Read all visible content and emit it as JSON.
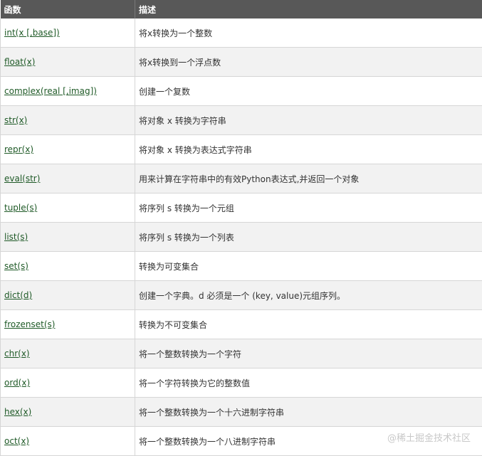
{
  "table": {
    "headers": [
      "函数",
      "描述"
    ],
    "rows": [
      {
        "fn": "int(x [,base])",
        "desc": "将x转换为一个整数"
      },
      {
        "fn": "float(x)",
        "desc": "将x转换到一个浮点数"
      },
      {
        "fn": "complex(real [,imag])",
        "desc": "创建一个复数"
      },
      {
        "fn": "str(x)",
        "desc": "将对象 x 转换为字符串"
      },
      {
        "fn": "repr(x)",
        "desc": "将对象 x 转换为表达式字符串"
      },
      {
        "fn": "eval(str)",
        "desc": "用来计算在字符串中的有效Python表达式,并返回一个对象"
      },
      {
        "fn": "tuple(s)",
        "desc": "将序列 s 转换为一个元组"
      },
      {
        "fn": "list(s)",
        "desc": "将序列 s 转换为一个列表"
      },
      {
        "fn": "set(s)",
        "desc": "转换为可变集合"
      },
      {
        "fn": "dict(d)",
        "desc": "创建一个字典。d 必须是一个 (key, value)元组序列。"
      },
      {
        "fn": "frozenset(s)",
        "desc": "转换为不可变集合"
      },
      {
        "fn": "chr(x)",
        "desc": "将一个整数转换为一个字符"
      },
      {
        "fn": "ord(x)",
        "desc": "将一个字符转换为它的整数值"
      },
      {
        "fn": "hex(x)",
        "desc": "将一个整数转换为一个十六进制字符串"
      },
      {
        "fn": "oct(x)",
        "desc": "将一个整数转换为一个八进制字符串"
      }
    ]
  },
  "watermark": "@稀土掘金技术社区",
  "colors": {
    "header_bg": "#585858",
    "link": "#1f5a27",
    "row_alt": "#f2f2f2"
  }
}
